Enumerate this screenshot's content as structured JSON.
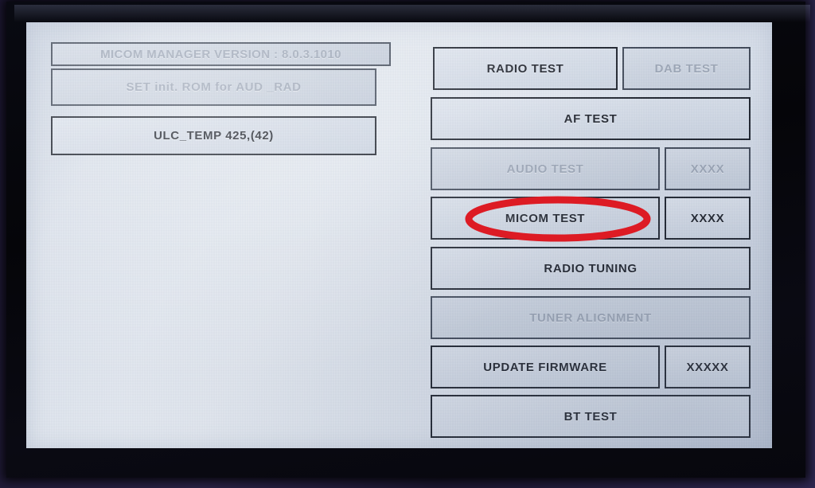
{
  "device": {
    "screen_label": "micom-manager-service-menu",
    "bezel_color": "#07070d",
    "screen_background": "#dfe5ee",
    "marker_color": "#dd1b24"
  },
  "left_panel": {
    "version_box": {
      "label": "MICOM MANAGER VERSION : 8.0.3.1010",
      "enabled": false
    },
    "items": [
      {
        "label": "SET init. ROM for AUD _RAD",
        "enabled": false
      },
      {
        "label": "ULC_TEMP 425,(42)",
        "enabled": true
      }
    ]
  },
  "right_panel": {
    "rows": [
      {
        "main": "RADIO TEST",
        "main_enabled": true,
        "side": "DAB TEST",
        "side_enabled": false,
        "side_wide": true
      },
      {
        "main": "AF TEST",
        "main_enabled": true,
        "side": null,
        "side_enabled": false,
        "side_wide": false
      },
      {
        "main": "AUDIO TEST",
        "main_enabled": false,
        "side": "XXXX",
        "side_enabled": false,
        "side_wide": false
      },
      {
        "main": "MICOM TEST",
        "main_enabled": true,
        "side": "XXXX",
        "side_enabled": true,
        "side_wide": false
      },
      {
        "main": "RADIO TUNING",
        "main_enabled": true,
        "side": null,
        "side_enabled": false,
        "side_wide": false
      },
      {
        "main": "TUNER ALIGNMENT",
        "main_enabled": false,
        "side": null,
        "side_enabled": false,
        "side_wide": false
      },
      {
        "main": "UPDATE FIRMWARE",
        "main_enabled": true,
        "side": "XXXXX",
        "side_enabled": true,
        "side_wide": false
      },
      {
        "main": "BT TEST",
        "main_enabled": true,
        "side": null,
        "side_enabled": false,
        "side_wide": false
      }
    ]
  },
  "annotation": {
    "type": "ellipse-highlight",
    "target": "MICOM TEST",
    "color": "#dd1b24"
  }
}
